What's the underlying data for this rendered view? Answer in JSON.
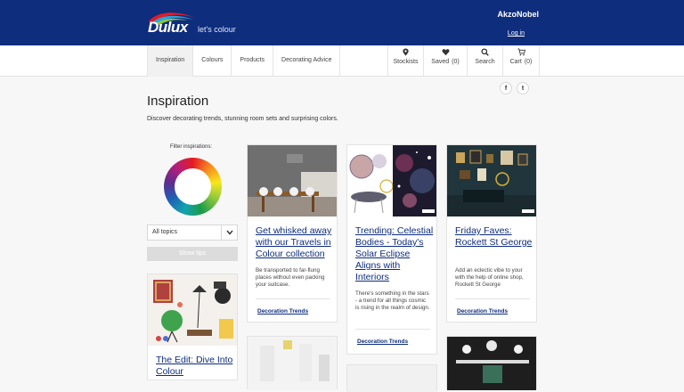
{
  "header": {
    "brand": "Dulux",
    "tagline": "let's colour",
    "corp": "AkzoNobel",
    "login": "Log in"
  },
  "nav": {
    "items": [
      "Inspiration",
      "Colours",
      "Products",
      "Decorating Advice"
    ],
    "active": "Inspiration",
    "tools": [
      {
        "label": "Stockists",
        "count": "",
        "icon": "map-pin-icon"
      },
      {
        "label": "Saved",
        "count": "(0)",
        "icon": "heart-icon"
      },
      {
        "label": "Search",
        "count": "",
        "icon": "search-icon"
      },
      {
        "label": "Cart",
        "count": "(0)",
        "icon": "cart-icon"
      }
    ]
  },
  "page": {
    "title": "Inspiration",
    "intro": "Discover decorating trends, stunning room sets and surprising colors.",
    "social": [
      "f",
      "t"
    ]
  },
  "filter": {
    "label": "Filter inspirations:",
    "select_value": "All topics",
    "button": "Show tips"
  },
  "cards": [
    {
      "title": "Get whisked away with our Travels in Colour collection",
      "desc": "Be transported to far-flung places without even packing your suitcase.",
      "tag": "Decoration Trends"
    },
    {
      "title": "Trending: Celestial Bodies - Today's Solar Eclipse Aligns with Interiors",
      "desc": "There's something in the stars - a trend for all things cosmic is rising in the realm of design.",
      "tag": "Decoration Trends"
    },
    {
      "title": "Friday Faves: Rockett St George",
      "desc": "Add an eclectic vibe to your with the help of online shop, Rockett St George",
      "tag": "Decoration Trends"
    },
    {
      "title": "The Edit: Dive Into Colour",
      "desc": "",
      "tag": ""
    }
  ],
  "colors": {
    "brand": "#0e2d7d",
    "link": "#0e2d7d",
    "background": "#f7f7f7"
  }
}
